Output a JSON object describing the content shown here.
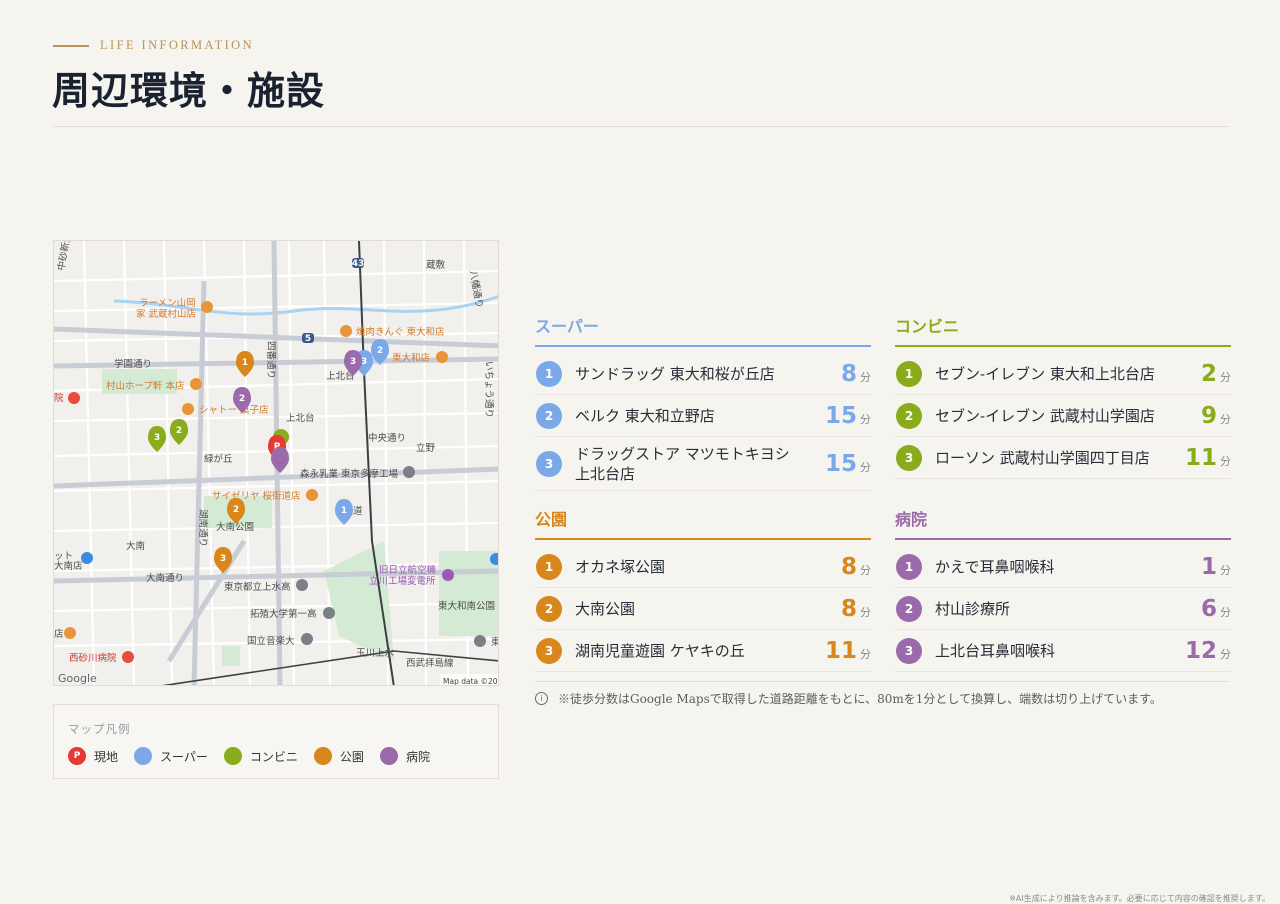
{
  "header": {
    "eyebrow": "LIFE INFORMATION",
    "title": "周辺環境・施設"
  },
  "map": {
    "labels": {
      "ramen": "ラーメン山岡",
      "ramen2": "家 武蔵村山店",
      "yakiniku": "焼肉きんぐ 東大和店",
      "higashiyamato_store": "東大和店",
      "gakuen_dori": "学園通り",
      "hope": "村山ホープ軒 本店",
      "chateraise": "シャトー 菓子店",
      "kamikita": "上北台",
      "kamikitadai": "上北台",
      "chuo_dori": "中央通り",
      "tateno": "立野",
      "midorigaoka": "緑が丘",
      "morinaga": "森永乳業 東京多摩工場",
      "saizeriya": "サイゼリヤ 桜街道店",
      "onan_park": "大南公園",
      "onan": "大南",
      "onan_dori": "大南通り",
      "tokyo_hs": "東京都立上水高",
      "takushoku": "拓殖大学第一高",
      "kunitachi_music": "国立音楽大",
      "tachikawa_museum": "旧日立航空機",
      "tachikawa_museum2": "立川工場変電所",
      "higashiyamato_park": "東大和南公園",
      "nishisunagawa": "西砂川病院",
      "tamagawa": "玉川上水",
      "seibu": "西武拝島線",
      "kurashiki": "蔵敷",
      "yakumo": "八幡通り",
      "nakasuna": "中砂新道",
      "shichi": "四番通り",
      "konan": "湖南通り",
      "ichou": "いちょう通り",
      "hospital_left": "院",
      "nanmise": "ット",
      "nanmise2": "大南店",
      "higashi": "東",
      "mise": "店",
      "kaido": "道",
      "route43": "43",
      "route5": "5",
      "google": "Google",
      "attribution": "Map data ©2026"
    },
    "pins": {
      "super_1": "1",
      "super_2": "2",
      "super_3": "3",
      "conv_2": "2",
      "conv_3": "3",
      "park_1": "1",
      "park_2": "2",
      "park_3": "3",
      "hosp_2": "2",
      "hosp_3": "3",
      "site": "P"
    }
  },
  "legend": {
    "title": "マップ凡例",
    "items": [
      {
        "label": "現地",
        "color": "#e53935",
        "glyph": "P"
      },
      {
        "label": "スーパー",
        "color": "#7aa8e8",
        "glyph": ""
      },
      {
        "label": "コンビニ",
        "color": "#8aab1c",
        "glyph": ""
      },
      {
        "label": "公園",
        "color": "#d9861a",
        "glyph": ""
      },
      {
        "label": "病院",
        "color": "#9b6aaa",
        "glyph": ""
      }
    ]
  },
  "colors": {
    "super": "#7aa8e8",
    "conv": "#8aab1c",
    "park": "#d9861a",
    "hosp": "#9b6aaa",
    "site": "#e53935",
    "accent": "#b8935a"
  },
  "categories": {
    "super": {
      "title": "スーパー",
      "items": [
        {
          "num": "1",
          "name": "サンドラッグ 東大和桜が丘店",
          "minutes": "8",
          "unit": "分"
        },
        {
          "num": "2",
          "name": "ベルク 東大和立野店",
          "minutes": "15",
          "unit": "分"
        },
        {
          "num": "3",
          "name_line1": "ドラッグストア マツモトキヨシ",
          "name_line2": "上北台店",
          "minutes": "15",
          "unit": "分"
        }
      ]
    },
    "conv": {
      "title": "コンビニ",
      "items": [
        {
          "num": "1",
          "name": "セブン-イレブン 東大和上北台店",
          "minutes": "2",
          "unit": "分"
        },
        {
          "num": "2",
          "name": "セブン-イレブン 武蔵村山学園店",
          "minutes": "9",
          "unit": "分"
        },
        {
          "num": "3",
          "name": "ローソン 武蔵村山学園四丁目店",
          "minutes": "11",
          "unit": "分"
        }
      ]
    },
    "park": {
      "title": "公園",
      "items": [
        {
          "num": "1",
          "name": "オカネ塚公園",
          "minutes": "8",
          "unit": "分"
        },
        {
          "num": "2",
          "name": "大南公園",
          "minutes": "8",
          "unit": "分"
        },
        {
          "num": "3",
          "name": "湖南児童遊園 ケヤキの丘",
          "minutes": "11",
          "unit": "分"
        }
      ]
    },
    "hosp": {
      "title": "病院",
      "items": [
        {
          "num": "1",
          "name": "かえで耳鼻咽喉科",
          "minutes": "1",
          "unit": "分"
        },
        {
          "num": "2",
          "name": "村山診療所",
          "minutes": "6",
          "unit": "分"
        },
        {
          "num": "3",
          "name": "上北台耳鼻咽喉科",
          "minutes": "12",
          "unit": "分"
        }
      ]
    }
  },
  "note": {
    "icon": "i",
    "text": "※徒歩分数はGoogle Mapsで取得した道路距離をもとに、80mを1分として換算し、端数は切り上げています。"
  },
  "footer": "※AI生成により推論を含みます。必要に応じて内容の確認を推奨します。"
}
